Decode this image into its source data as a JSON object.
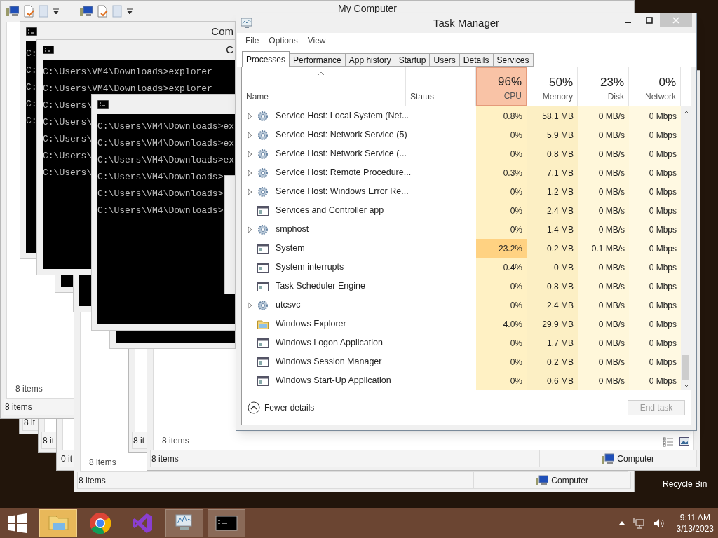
{
  "explorer_windows": [
    {
      "status": "8 it"
    },
    {
      "status": "8 it"
    },
    {
      "status": "0 it"
    },
    {
      "toolbar": true,
      "pane_status": "8 items",
      "status": "8 items"
    },
    {
      "toolbar": true,
      "title": "My Computer",
      "pane_status": "8 items",
      "status": "8 items",
      "location": "Computer"
    },
    {
      "status": "8 it"
    },
    {
      "pane_status": "8 items",
      "status": "8 items",
      "location": "Computer"
    }
  ],
  "console_windows": [
    {
      "title": "Com",
      "lines": [
        "C:",
        "C:",
        "C:",
        "C:",
        "C:"
      ]
    },
    {
      "title": "C",
      "lines": [
        "C:\\Users\\VM4\\Downloads>explorer",
        "C:\\Users\\VM4\\Downloads>explorer",
        "C:\\Users\\",
        "C:\\Users\\",
        "C:\\Users\\",
        "C:\\Users\\",
        "C:\\Users\\"
      ]
    },
    {
      "lines": [
        "C:\\Users\\VM4\\Downloads>ex",
        "C:\\Users\\VM4\\Downloads>ex",
        "C:\\Users\\VM4\\Downloads>ex",
        "C:\\Users\\VM4\\Downloads>",
        "C:\\Users\\VM4\\Downloads>",
        "C:\\Users\\VM4\\Downloads>"
      ]
    }
  ],
  "task_manager": {
    "title": "Task Manager",
    "menu": [
      "File",
      "Options",
      "View"
    ],
    "tabs": [
      {
        "label": "Processes",
        "selected": true
      },
      {
        "label": "Performance",
        "selected": false
      },
      {
        "label": "App history",
        "selected": false
      },
      {
        "label": "Startup",
        "selected": false
      },
      {
        "label": "Users",
        "selected": false
      },
      {
        "label": "Details",
        "selected": false
      },
      {
        "label": "Services",
        "selected": false
      }
    ],
    "columns": [
      {
        "label": "Name"
      },
      {
        "label": "Status"
      },
      {
        "value": "96%",
        "label": "CPU",
        "hot": true
      },
      {
        "value": "50%",
        "label": "Memory",
        "hot": false
      },
      {
        "value": "23%",
        "label": "Disk",
        "hot": false
      },
      {
        "value": "0%",
        "label": "Network",
        "hot": false
      }
    ],
    "rows": [
      {
        "name": "Service Host: Local System (Net...",
        "kind": "service",
        "expandable": true,
        "cpu": "0.8%",
        "memory": "58.1 MB",
        "disk": "0 MB/s",
        "network": "0 Mbps",
        "cpu_hot": false
      },
      {
        "name": "Service Host: Network Service (5)",
        "kind": "service",
        "expandable": true,
        "cpu": "0%",
        "memory": "5.9 MB",
        "disk": "0 MB/s",
        "network": "0 Mbps",
        "cpu_hot": false
      },
      {
        "name": "Service Host: Network Service (...",
        "kind": "service",
        "expandable": true,
        "cpu": "0%",
        "memory": "0.8 MB",
        "disk": "0 MB/s",
        "network": "0 Mbps",
        "cpu_hot": false
      },
      {
        "name": "Service Host: Remote Procedure...",
        "kind": "service",
        "expandable": true,
        "cpu": "0.3%",
        "memory": "7.1 MB",
        "disk": "0 MB/s",
        "network": "0 Mbps",
        "cpu_hot": false
      },
      {
        "name": "Service Host: Windows Error Re...",
        "kind": "service",
        "expandable": true,
        "cpu": "0%",
        "memory": "1.2 MB",
        "disk": "0 MB/s",
        "network": "0 Mbps",
        "cpu_hot": false
      },
      {
        "name": "Services and Controller app",
        "kind": "app",
        "expandable": false,
        "cpu": "0%",
        "memory": "2.4 MB",
        "disk": "0 MB/s",
        "network": "0 Mbps",
        "cpu_hot": false
      },
      {
        "name": "smphost",
        "kind": "service",
        "expandable": true,
        "cpu": "0%",
        "memory": "1.4 MB",
        "disk": "0 MB/s",
        "network": "0 Mbps",
        "cpu_hot": false
      },
      {
        "name": "System",
        "kind": "app",
        "expandable": false,
        "cpu": "23.2%",
        "memory": "0.2 MB",
        "disk": "0.1 MB/s",
        "network": "0 Mbps",
        "cpu_hot": true
      },
      {
        "name": "System interrupts",
        "kind": "app",
        "expandable": false,
        "cpu": "0.4%",
        "memory": "0 MB",
        "disk": "0 MB/s",
        "network": "0 Mbps",
        "cpu_hot": false
      },
      {
        "name": "Task Scheduler Engine",
        "kind": "app",
        "expandable": false,
        "cpu": "0%",
        "memory": "0.8 MB",
        "disk": "0 MB/s",
        "network": "0 Mbps",
        "cpu_hot": false
      },
      {
        "name": "utcsvc",
        "kind": "service",
        "expandable": true,
        "cpu": "0%",
        "memory": "2.4 MB",
        "disk": "0 MB/s",
        "network": "0 Mbps",
        "cpu_hot": false
      },
      {
        "name": "Windows Explorer",
        "kind": "folder",
        "expandable": false,
        "cpu": "4.0%",
        "memory": "29.9 MB",
        "disk": "0 MB/s",
        "network": "0 Mbps",
        "cpu_hot": false
      },
      {
        "name": "Windows Logon Application",
        "kind": "app",
        "expandable": false,
        "cpu": "0%",
        "memory": "1.7 MB",
        "disk": "0 MB/s",
        "network": "0 Mbps",
        "cpu_hot": false
      },
      {
        "name": "Windows Session Manager",
        "kind": "app",
        "expandable": false,
        "cpu": "0%",
        "memory": "0.2 MB",
        "disk": "0 MB/s",
        "network": "0 Mbps",
        "cpu_hot": false
      },
      {
        "name": "Windows Start-Up Application",
        "kind": "app",
        "expandable": false,
        "cpu": "0%",
        "memory": "0.6 MB",
        "disk": "0 MB/s",
        "network": "0 Mbps",
        "cpu_hot": false
      }
    ],
    "fewer_details": "Fewer details",
    "end_task": {
      "label": "End task",
      "disabled": true
    }
  },
  "desktop_icon": "Recycle Bin",
  "taskbar": {
    "apps": [
      {
        "kind": "explorer",
        "running": true
      },
      {
        "kind": "chrome",
        "running": false
      },
      {
        "kind": "studio",
        "running": false
      },
      {
        "kind": "monitor",
        "running": true
      },
      {
        "kind": "console",
        "running": true
      }
    ],
    "time": "9:11 AM",
    "date": "3/13/2023"
  }
}
